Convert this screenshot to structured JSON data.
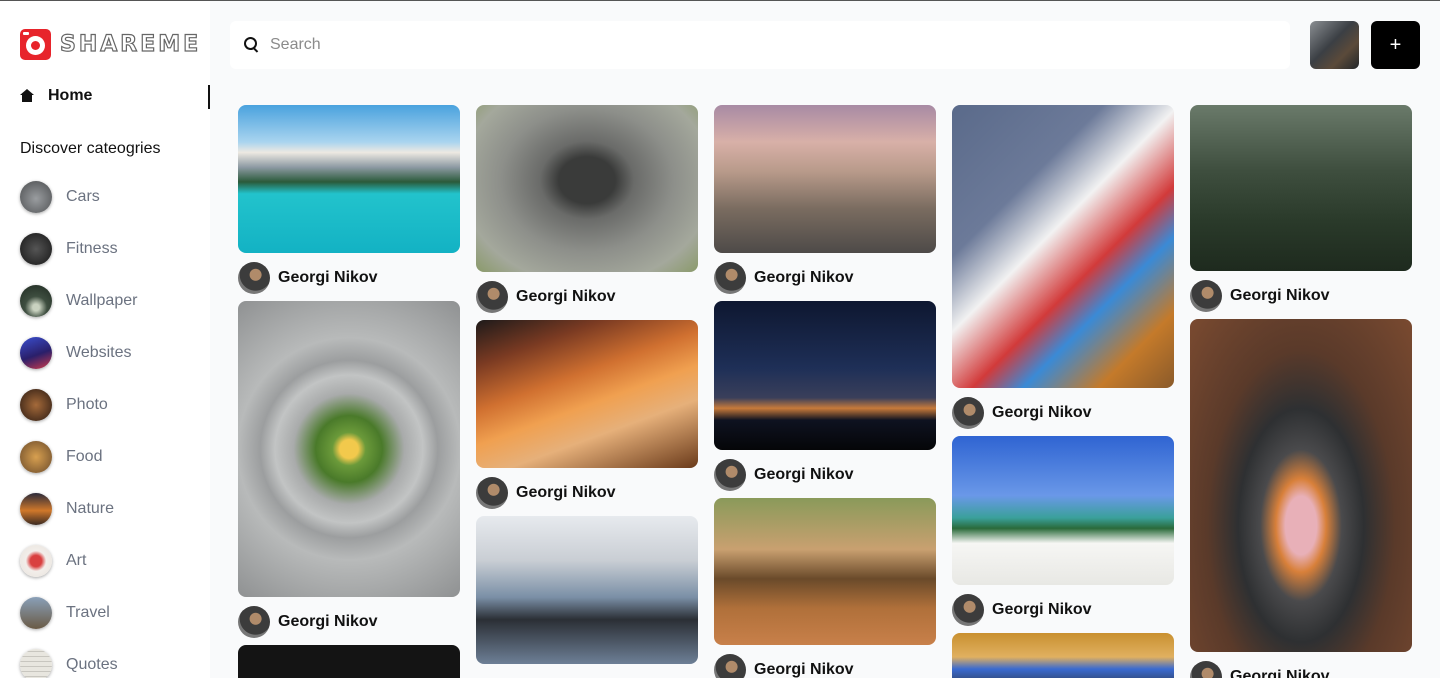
{
  "app": {
    "logo_text": "SHAREME"
  },
  "sidebar": {
    "home_label": "Home",
    "discover_label": "Discover cateogries",
    "categories": [
      {
        "label": "Cars",
        "color": "#6b6e72"
      },
      {
        "label": "Fitness",
        "color": "#2d2f31"
      },
      {
        "label": "Wallpaper",
        "color": "#3b4a3d"
      },
      {
        "label": "Websites",
        "color": "#3c2a8a"
      },
      {
        "label": "Photo",
        "color": "#5a3b2a"
      },
      {
        "label": "Food",
        "color": "#8a5a34"
      },
      {
        "label": "Nature",
        "color": "#b06a2c"
      },
      {
        "label": "Art",
        "color": "#c9403a"
      },
      {
        "label": "Travel",
        "color": "#7a6a55"
      },
      {
        "label": "Quotes",
        "color": "#d8d6cf"
      }
    ]
  },
  "header": {
    "search_placeholder": "Search",
    "add_label": "+"
  },
  "feed": {
    "columns": [
      [
        {
          "user": "Georgi Nikov",
          "subject": "lake-mountains",
          "colors": [
            "#5aa0d8",
            "#1fb9c9"
          ]
        },
        {
          "user": "Georgi Nikov",
          "subject": "avocado-toast",
          "colors": [
            "#9ea0a1",
            "#6e8f3a"
          ]
        },
        {
          "user": "",
          "subject": "dark-photo",
          "colors": [
            "#1a1a1a",
            "#2a2a2a"
          ]
        }
      ],
      [
        {
          "user": "Georgi Nikov",
          "subject": "grey-dog",
          "colors": [
            "#8a8b86",
            "#5e6a4a"
          ]
        },
        {
          "user": "Georgi Nikov",
          "subject": "painting-palette",
          "colors": [
            "#c96a2a",
            "#5a3a1a"
          ]
        },
        {
          "user": "",
          "subject": "camera-laptop",
          "colors": [
            "#cfd4d9",
            "#5b6f86"
          ]
        }
      ],
      [
        {
          "user": "Georgi Nikov",
          "subject": "hot-air-balloons",
          "colors": [
            "#b89ab0",
            "#7a6a5a"
          ]
        },
        {
          "user": "Georgi Nikov",
          "subject": "phone-tripod",
          "colors": [
            "#1d2a4d",
            "#0d1424"
          ]
        },
        {
          "user": "Georgi Nikov",
          "subject": "dogs-playing",
          "colors": [
            "#8aa05a",
            "#a86a3a"
          ]
        }
      ],
      [
        {
          "user": "Georgi Nikov",
          "subject": "dogs-kissing",
          "colors": [
            "#6c7a99",
            "#b5782e"
          ]
        },
        {
          "user": "Georgi Nikov",
          "subject": "palm-beach",
          "colors": [
            "#3f72d6",
            "#f3f4f2"
          ]
        },
        {
          "user": "",
          "subject": "desk-laptop",
          "colors": [
            "#c9922e",
            "#8a5a1a"
          ]
        }
      ],
      [
        {
          "user": "Georgi Nikov",
          "subject": "misty-forest",
          "colors": [
            "#4a5a4a",
            "#1e2a1e"
          ]
        },
        {
          "user": "Georgi Nikov",
          "subject": "cooking-bowl",
          "colors": [
            "#5a3a2a",
            "#3a3c3e"
          ]
        }
      ]
    ]
  }
}
